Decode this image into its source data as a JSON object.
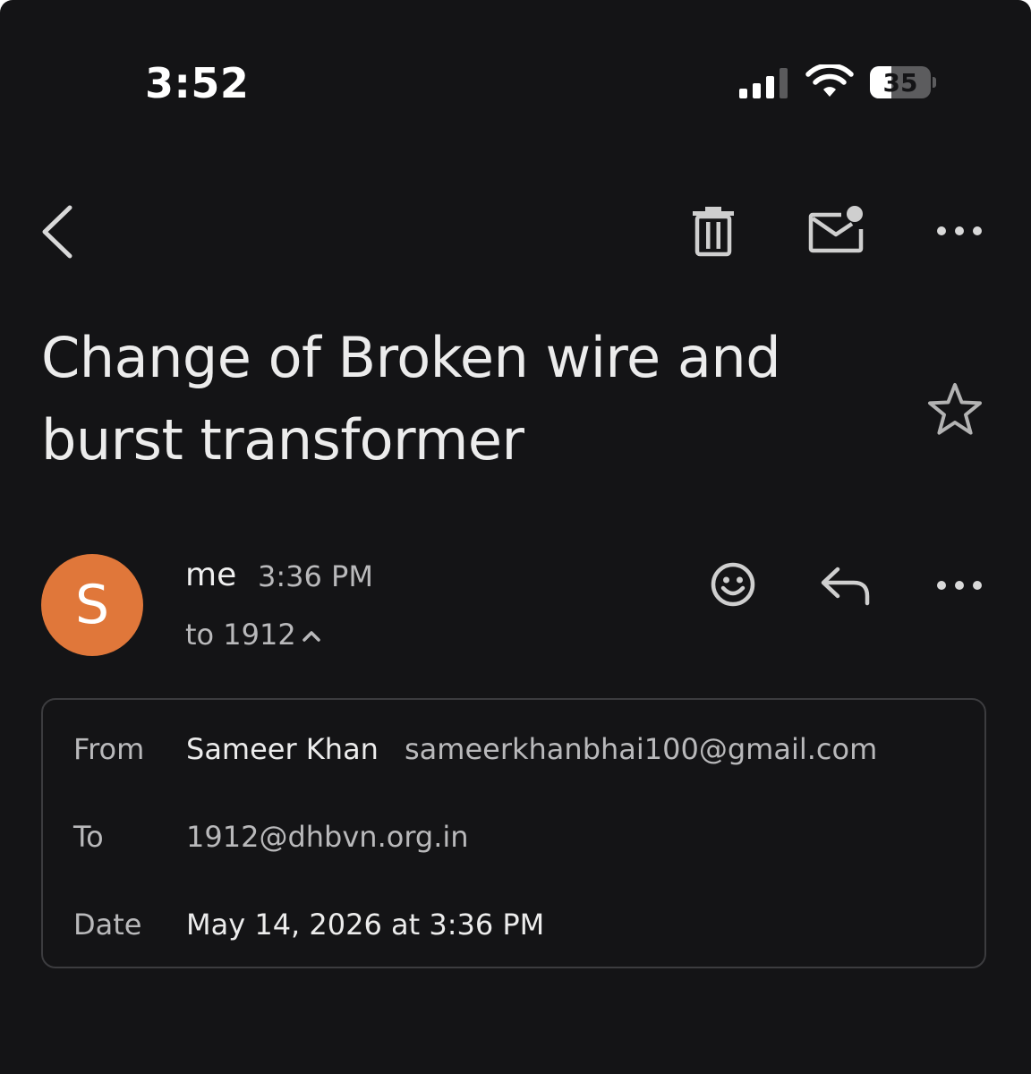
{
  "status_bar": {
    "time": "3:52",
    "battery_level": "35",
    "battery_fraction": 0.35,
    "signal_bars": 3,
    "icons": [
      "cellular-signal-icon",
      "wifi-icon",
      "battery-icon"
    ]
  },
  "toolbar": {
    "icons": [
      "back-chevron-icon",
      "trash-icon",
      "mark-unread-icon",
      "more-horizontal-icon"
    ]
  },
  "email": {
    "subject": "Change of Broken wire and burst transformer",
    "starred": false
  },
  "message": {
    "avatar_initial": "S",
    "avatar_color": "#e0773a",
    "sender": "me",
    "time": "3:36 PM",
    "recipient_summary": "to 1912"
  },
  "details": {
    "from_label": "From",
    "from_name": "Sameer Khan",
    "from_email": "sameerkhanbhai100@gmail.com",
    "to_label": "To",
    "to_value": "1912@dhbvn.org.in",
    "date_label": "Date",
    "date_value": "May 14, 2026 at 3:36 PM"
  },
  "theme": {
    "background": "#141416",
    "text_primary": "#ececec",
    "text_secondary": "#b9b9bb",
    "border": "#3c3c3f"
  }
}
